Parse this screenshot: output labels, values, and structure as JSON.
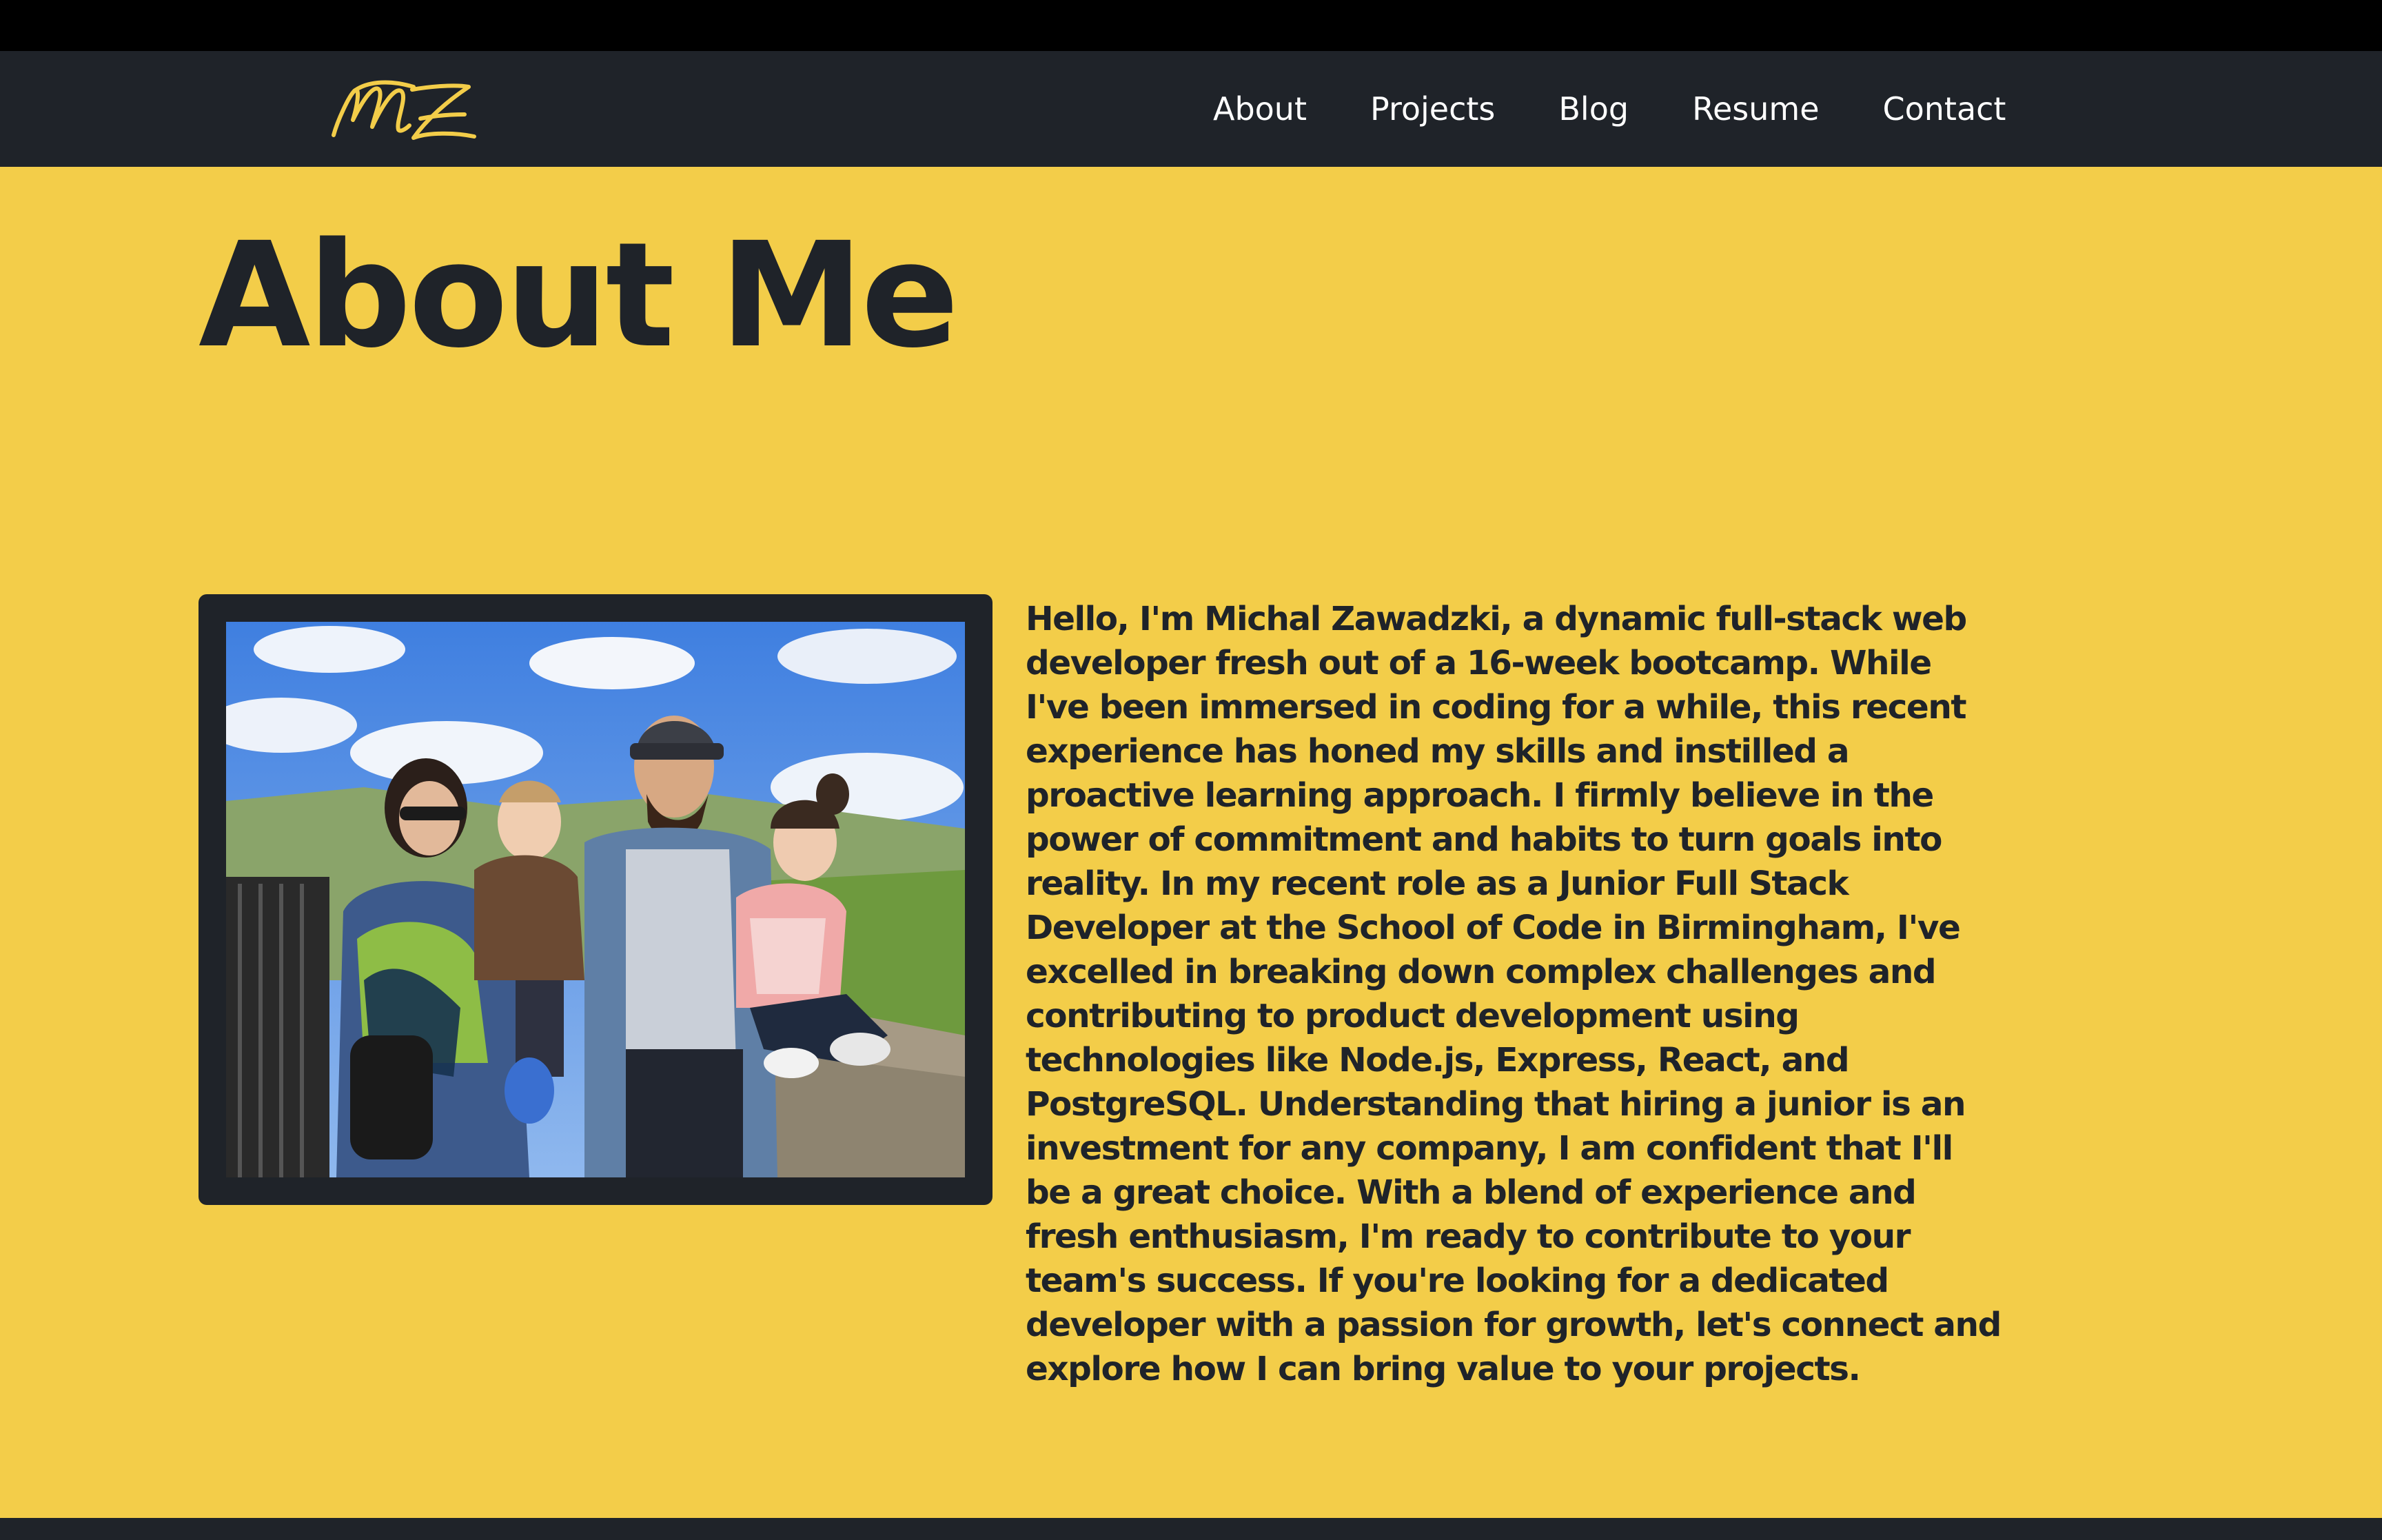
{
  "header": {
    "logo_text": "MZ",
    "nav": [
      {
        "label": "About"
      },
      {
        "label": "Projects"
      },
      {
        "label": "Blog"
      },
      {
        "label": "Resume"
      },
      {
        "label": "Contact"
      }
    ]
  },
  "main": {
    "title": "About Me",
    "bio": "Hello, I'm Michal Zawadzki, a dynamic full-stack web developer fresh out of a 16-week bootcamp. While I've been immersed in coding for a while, this recent experience has honed my skills and instilled a proactive learning approach. I firmly believe in the power of commitment and habits to turn goals into reality. In my recent role as a Junior Full Stack Developer at the School of Code in Birmingham, I've excelled in breaking down complex challenges and contributing to product development using technologies like Node.js, Express, React, and PostgreSQL. Understanding that hiring a junior is an investment for any company, I am confident that I'll be a great choice. With a blend of experience and fresh enthusiasm, I'm ready to contribute to your team's success. If you're looking for a dedicated developer with a passion for growth, let's connect and explore how I can bring value to your projects."
  },
  "colors": {
    "accent": "#f3cd49",
    "dark": "#1f2329",
    "nav_text": "#ffffff"
  }
}
